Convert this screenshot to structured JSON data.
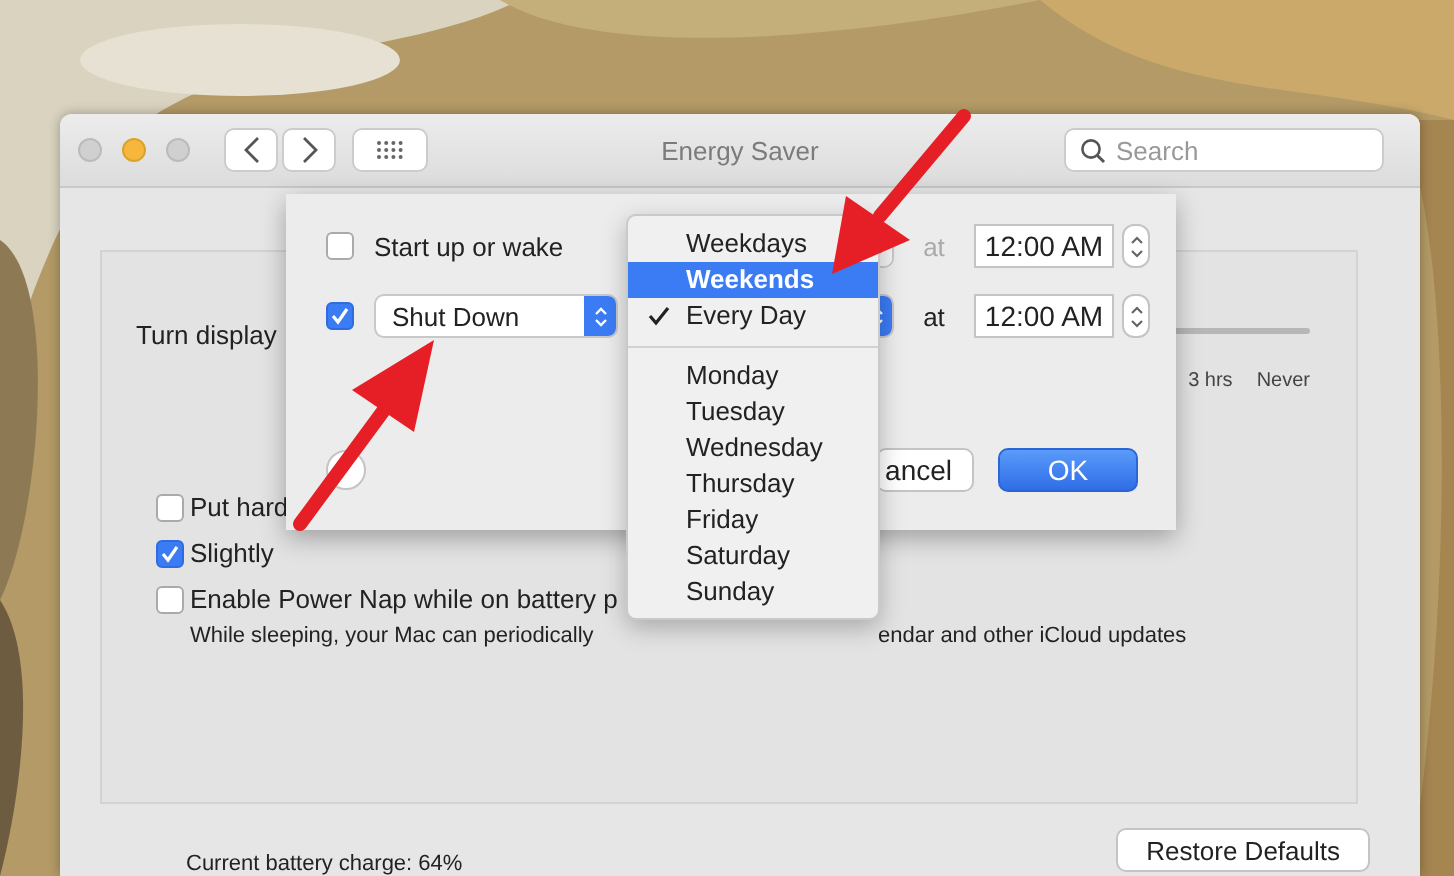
{
  "window": {
    "title": "Energy Saver",
    "search": {
      "placeholder": "Search"
    }
  },
  "settings": {
    "display_label": "Turn display",
    "slider_labels": [
      "3 hrs",
      "Never"
    ],
    "options": [
      {
        "label": "Put hard",
        "checked": false
      },
      {
        "label": "Slightly",
        "checked": true
      },
      {
        "label": "Enable Power Nap while on battery p",
        "checked": false,
        "note_parts": [
          "While sleeping, your Mac can periodically",
          "endar and other iCloud updates"
        ]
      }
    ],
    "battery": "Current battery charge: 64%",
    "restore_button": "Restore Defaults"
  },
  "schedule_sheet": {
    "rows": [
      {
        "checked": false,
        "kind": "label",
        "action": "Start up or wake",
        "at": "at",
        "time": "12:00 AM"
      },
      {
        "checked": true,
        "kind": "popup",
        "action": "Shut Down",
        "at": "at",
        "time": "12:00 AM"
      }
    ],
    "buttons": [
      {
        "label": "ancel",
        "kind": "secondary"
      },
      {
        "label": "OK",
        "kind": "default"
      }
    ]
  },
  "day_menu": {
    "groups": [
      {
        "items": [
          {
            "label": "Weekdays",
            "selected": false,
            "checked": false
          },
          {
            "label": "Weekends",
            "selected": true,
            "checked": false
          },
          {
            "label": "Every Day",
            "selected": false,
            "checked": true
          }
        ]
      },
      {
        "items": [
          {
            "label": "Monday",
            "selected": false,
            "checked": false
          },
          {
            "label": "Tuesday",
            "selected": false,
            "checked": false
          },
          {
            "label": "Wednesday",
            "selected": false,
            "checked": false
          },
          {
            "label": "Thursday",
            "selected": false,
            "checked": false
          },
          {
            "label": "Friday",
            "selected": false,
            "checked": false
          },
          {
            "label": "Saturday",
            "selected": false,
            "checked": false
          },
          {
            "label": "Sunday",
            "selected": false,
            "checked": false
          }
        ]
      }
    ]
  }
}
